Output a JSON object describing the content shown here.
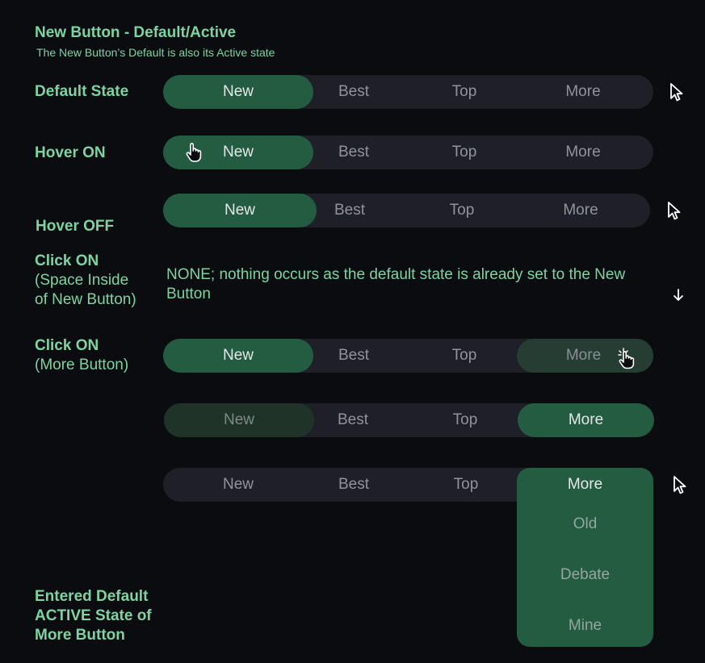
{
  "header": {
    "title": "New Button - Default/Active",
    "subtitle": "The New Button’s Default is also its Active state"
  },
  "tabs": [
    "New",
    "Best",
    "Top",
    "More"
  ],
  "labels": {
    "default_state": "Default State",
    "hover_on": "Hover ON",
    "hover_off": "Hover OFF",
    "click_on_new_1": "Click ON",
    "click_on_new_2": "(Space Inside",
    "click_on_new_3": "of New Button)",
    "click_on_new_note": "NONE; nothing occurs as the default state is already set to the New Button",
    "click_on_more_1": "Click ON",
    "click_on_more_2": "(More Button)",
    "entered_default_1": "Entered Default",
    "entered_default_2": "ACTIVE State of",
    "entered_default_3": "More Button"
  },
  "dropdown": {
    "header": "More",
    "items": [
      "Old",
      "Debate",
      "Mine"
    ]
  },
  "colors": {
    "background": "#0b0c10",
    "label_green": "#7ed3a2",
    "tabbar_bg": "#1f2027",
    "active_green": "#235c40"
  },
  "icons": [
    "arrow-cursor-icon",
    "hand-pointer-icon",
    "hand-click-icon",
    "arrow-down-icon"
  ]
}
